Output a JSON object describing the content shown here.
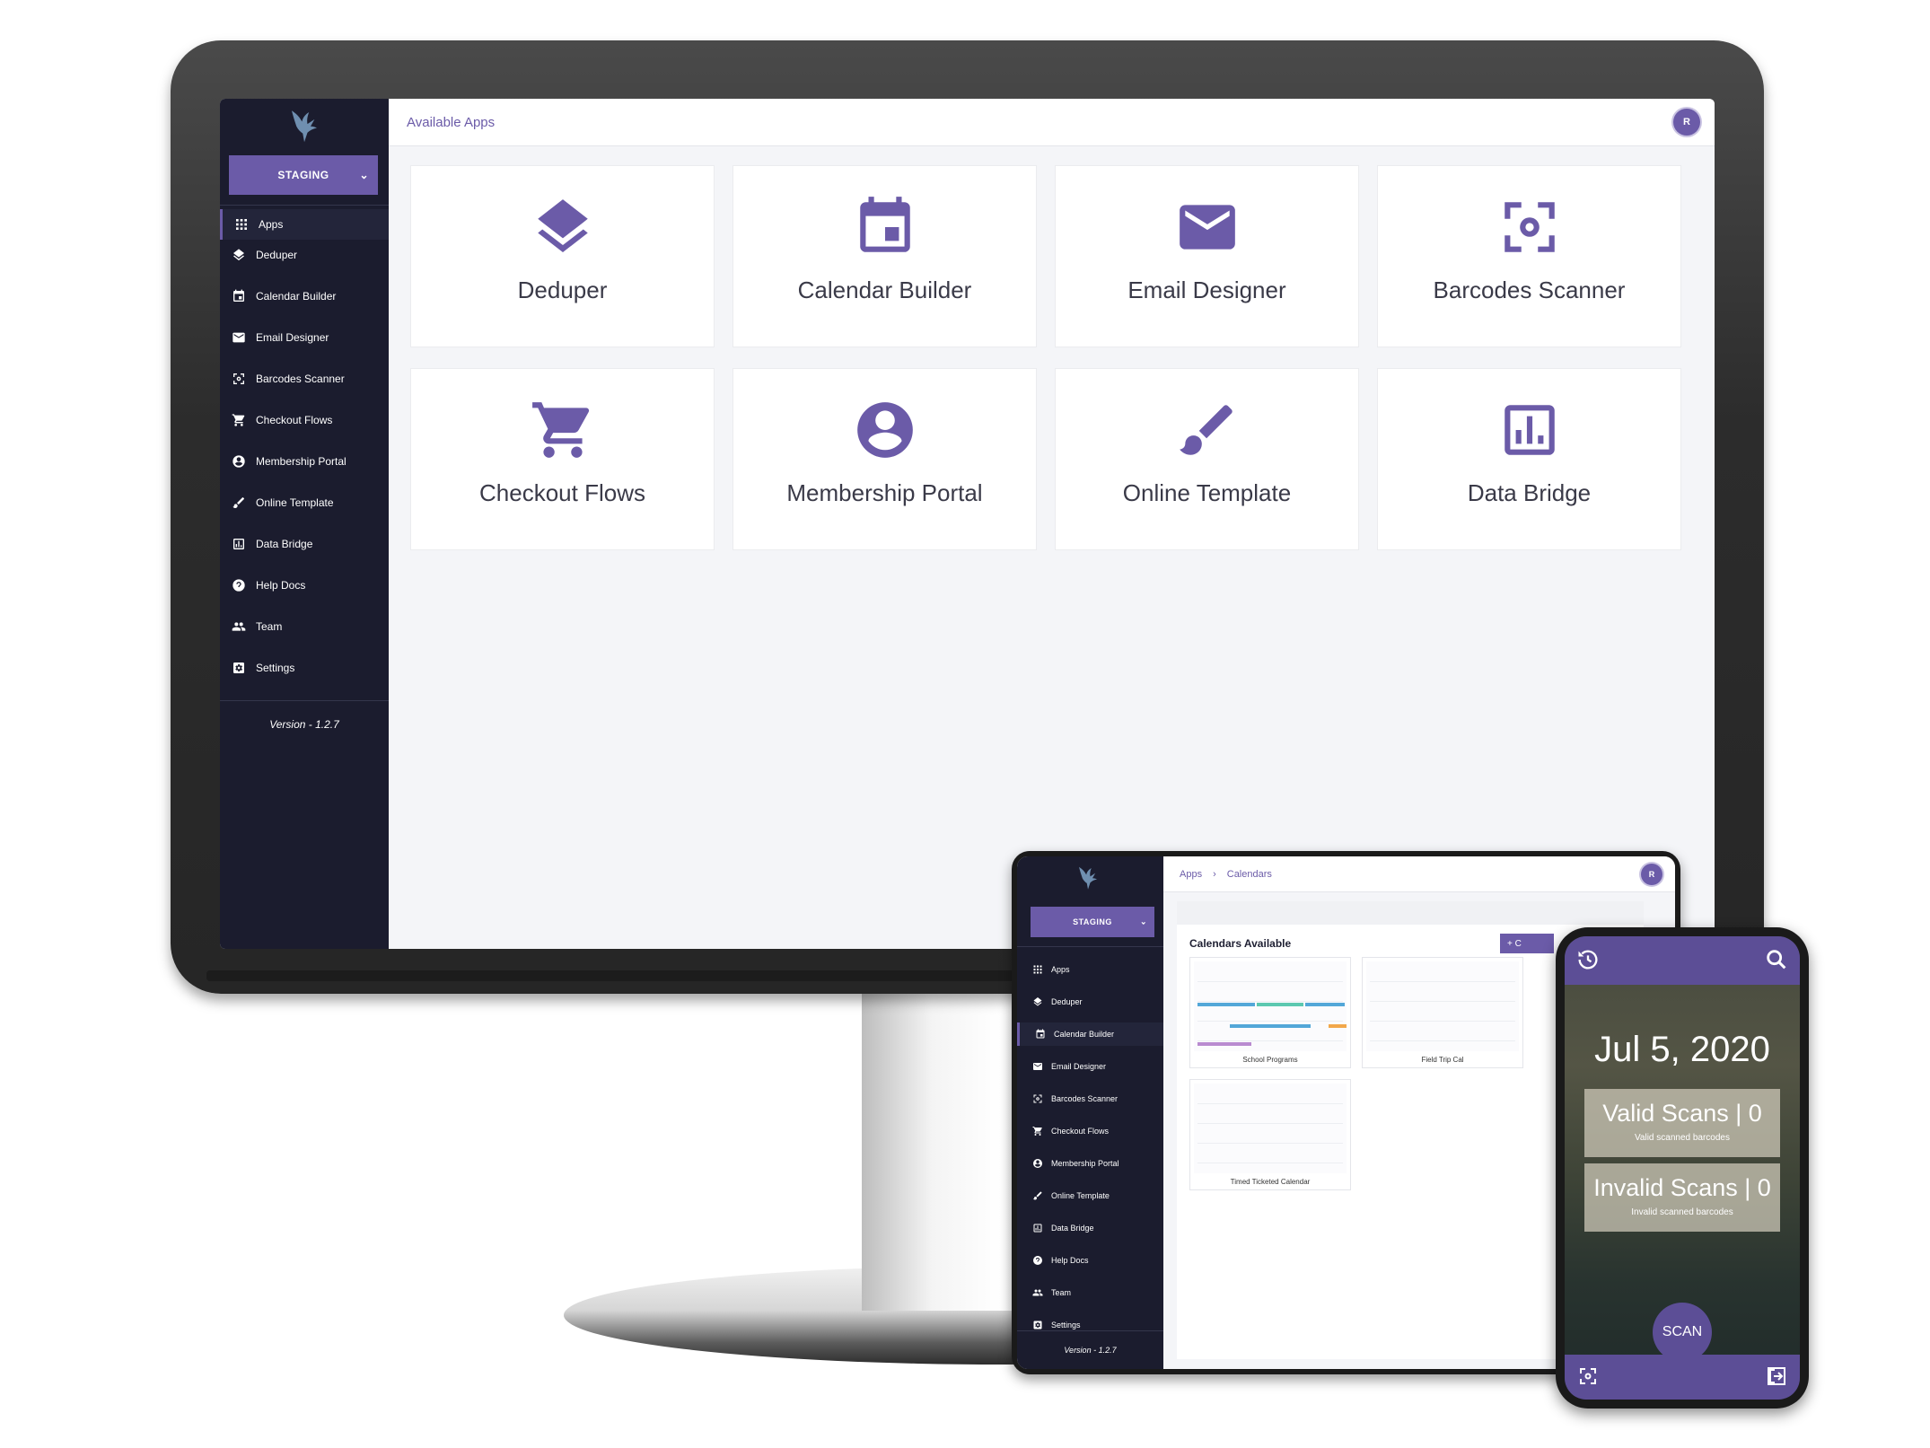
{
  "colors": {
    "accent": "#6b5ba8",
    "sidebar_bg": "#1b1c2e",
    "content_bg": "#f4f5f8",
    "card_bg": "#ffffff",
    "phone_bar": "#5c4e96"
  },
  "desktop": {
    "breadcrumb": "Available Apps",
    "environment": "STAGING",
    "avatar_initial": "R",
    "nav": [
      {
        "label": "Apps",
        "icon": "grid-icon"
      },
      {
        "label": "Deduper",
        "icon": "layers-icon"
      },
      {
        "label": "Calendar Builder",
        "icon": "calendar-icon"
      },
      {
        "label": "Email Designer",
        "icon": "envelope-icon"
      },
      {
        "label": "Barcodes Scanner",
        "icon": "scan-icon"
      },
      {
        "label": "Checkout Flows",
        "icon": "cart-icon"
      },
      {
        "label": "Membership Portal",
        "icon": "account-icon"
      },
      {
        "label": "Online Template",
        "icon": "brush-icon"
      },
      {
        "label": "Data Bridge",
        "icon": "chart-icon"
      },
      {
        "label": "Help Docs",
        "icon": "help-icon"
      },
      {
        "label": "Team",
        "icon": "team-icon"
      },
      {
        "label": "Settings",
        "icon": "settings-icon"
      }
    ],
    "version": "Version - 1.2.7",
    "apps": [
      {
        "label": "Deduper",
        "icon": "layers-icon"
      },
      {
        "label": "Calendar Builder",
        "icon": "calendar-icon"
      },
      {
        "label": "Email Designer",
        "icon": "envelope-icon"
      },
      {
        "label": "Barcodes Scanner",
        "icon": "scan-icon"
      },
      {
        "label": "Checkout Flows",
        "icon": "cart-icon"
      },
      {
        "label": "Membership Portal",
        "icon": "account-icon"
      },
      {
        "label": "Online Template",
        "icon": "brush-icon"
      },
      {
        "label": "Data Bridge",
        "icon": "chart-icon"
      }
    ]
  },
  "tablet": {
    "breadcrumb": [
      "Apps",
      "Calendars"
    ],
    "environment": "STAGING",
    "avatar_initial": "R",
    "heading": "Calendars Available",
    "add_label": "+ C",
    "calendars": [
      "School Programs",
      "Field Trip Cal",
      "Timed Ticketed Calendar"
    ],
    "version": "Version - 1.2.7"
  },
  "phone": {
    "date": "Jul 5, 2020",
    "valid": {
      "title": "Valid Scans | 0",
      "subtitle": "Valid scanned barcodes"
    },
    "invalid": {
      "title": "Invalid Scans | 0",
      "subtitle": "Invalid scanned barcodes"
    },
    "scan_label": "SCAN"
  }
}
